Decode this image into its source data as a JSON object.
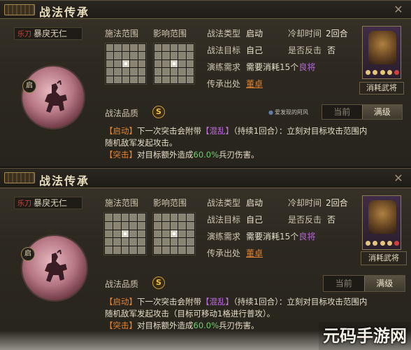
{
  "panels": [
    {
      "title": "战法传承",
      "close": "✕",
      "skill_tag": "乐刀",
      "skill_name": "暴戾无仁",
      "qi_badge": "启",
      "range_label": "施法范围",
      "effect_label": "影响范围",
      "type_label": "战法类型",
      "type_value": "启动",
      "target_label": "战法目标",
      "target_value": "自己",
      "require_label": "演练需求",
      "require_prefix": "需要消耗",
      "require_count": "15个",
      "require_item": "良将",
      "source_label": "传承出处",
      "source_value": "董卓",
      "cooldown_label": "冷却时间",
      "cooldown_value": "2回合",
      "counter_label": "是否反击",
      "counter_value": "否",
      "hero_tag": "消耗武将",
      "quality_label": "战法品质",
      "quality_value": "S",
      "watermark_small": "爱发现的阿风",
      "toggle_left": "当前",
      "toggle_right": "满级",
      "desc_line1_a": "【启动】",
      "desc_line1_b": "下一次突击会附带",
      "desc_line1_c": "【混乱】",
      "desc_line1_d": "（持续1回合）：立刻对目标攻击范围内",
      "desc_line2": "随机敌军发起攻击。",
      "desc_line3_a": "【突击】",
      "desc_line3_b": "对目标额外造成",
      "desc_line3_c": "60.0%",
      "desc_line3_d": "兵刃伤害。"
    },
    {
      "title": "战法传承",
      "close": "✕",
      "skill_tag": "乐刀",
      "skill_name": "暴戾无仁",
      "qi_badge": "启",
      "range_label": "施法范围",
      "effect_label": "影响范围",
      "type_label": "战法类型",
      "type_value": "启动",
      "target_label": "战法目标",
      "target_value": "自己",
      "require_label": "演练需求",
      "require_prefix": "需要消耗",
      "require_count": "15个",
      "require_item": "良将",
      "source_label": "传承出处",
      "source_value": "董卓",
      "cooldown_label": "冷却时间",
      "cooldown_value": "2回合",
      "counter_label": "是否反击",
      "counter_value": "否",
      "hero_tag": "消耗武将",
      "quality_label": "战法品质",
      "quality_value": "S",
      "toggle_left": "当前",
      "toggle_right": "满级",
      "desc_line1_a": "【启动】",
      "desc_line1_b": "下一次突击会附带",
      "desc_line1_c": "【混乱】",
      "desc_line1_d": "（持续1回合）：立刻对目标攻击范围内",
      "desc_line2": "随机敌军发起攻击（目标可移动1格进行普攻）。",
      "desc_line3_a": "【突击】",
      "desc_line3_b": "对目标额外造成",
      "desc_line3_c": "60.0%",
      "desc_line3_d": "兵刃伤害。"
    }
  ],
  "bottom_watermark": "元码手游网",
  "colors": {
    "accent_orange": "#e2832f",
    "purple": "#c070e0",
    "red": "#e04a3a",
    "gold": "#f2c14a"
  }
}
